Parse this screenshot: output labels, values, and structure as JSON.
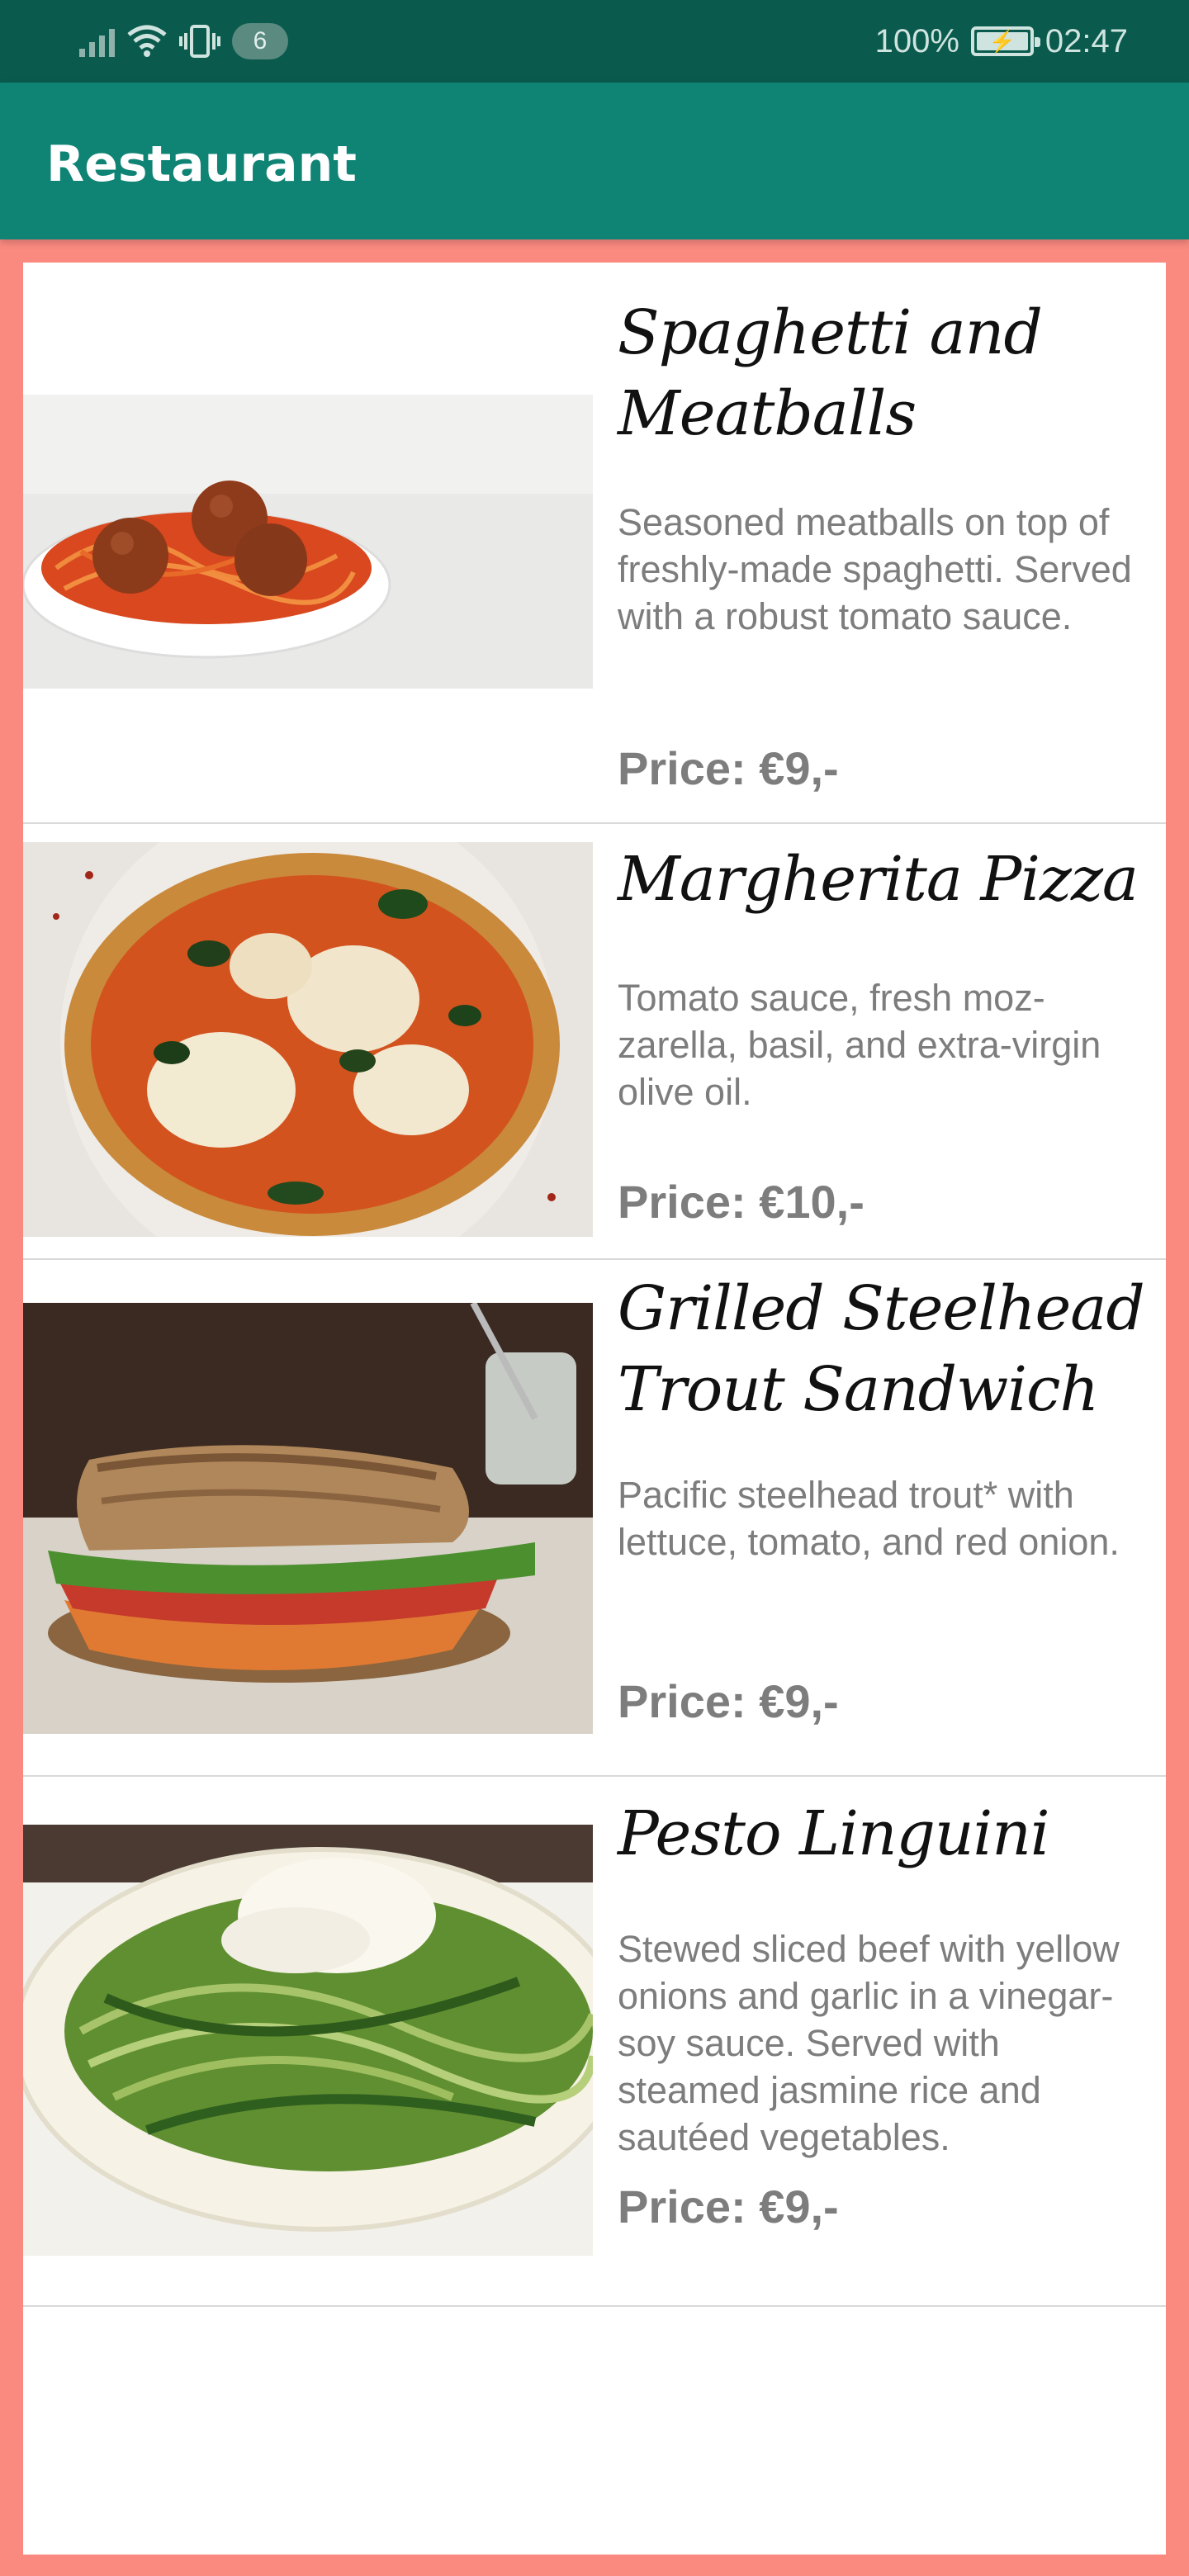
{
  "status": {
    "notification_count": "6",
    "battery": "100%",
    "time": "02:47"
  },
  "appbar": {
    "title": "Restaurant"
  },
  "menu": [
    {
      "name": "Spaghetti and Meatballs",
      "description": "Seasoned meatballs on top of freshly-made spaghetti. Served with a robust tomato sauce.",
      "price": "Price: €9,-",
      "image_icon": "spaghetti-meatballs-photo"
    },
    {
      "name": "Margherita Pizza",
      "description": "Tomato sauce, fresh moz-zarella, basil, and extra-virgin olive oil.",
      "price": "Price: €10,-",
      "image_icon": "margherita-pizza-photo"
    },
    {
      "name": "Grilled Steelhead Trout Sandwich",
      "description": "Pacific steelhead trout* with lettuce, tomato, and red onion.",
      "price": "Price: €9,-",
      "image_icon": "trout-sandwich-photo"
    },
    {
      "name": "Pesto Linguini",
      "description": "Stewed sliced beef with yellow onions and garlic in a vinegar-soy sauce. Served with steamed jasmine rice and sautéed vegetables.",
      "price": "Price: €9,-",
      "image_icon": "pesto-linguini-photo"
    }
  ],
  "colors": {
    "status_bar": "#0a5a4d",
    "app_bar": "#0f8374",
    "background": "#fa8a80",
    "card": "#ffffff",
    "secondary_text": "#7d7d7d"
  }
}
